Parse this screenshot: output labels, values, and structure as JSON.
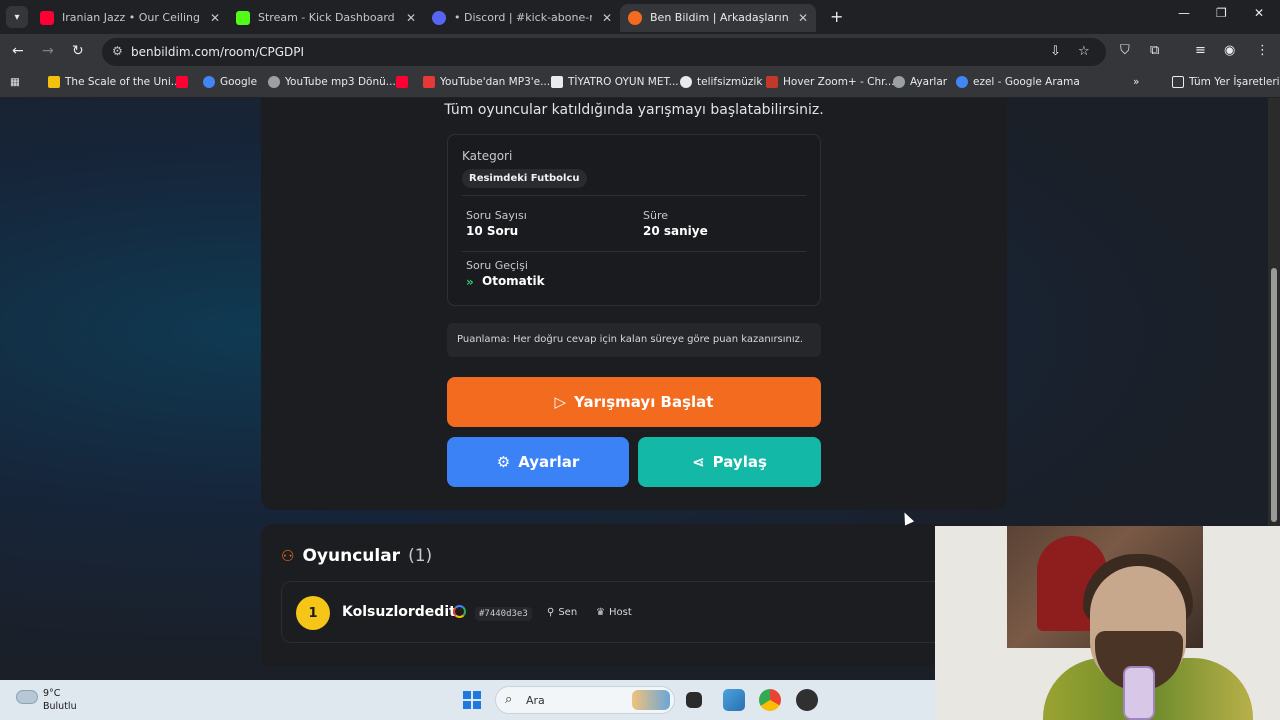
{
  "browser": {
    "tabs": [
      {
        "title": "Iranian Jazz • Our Ceilings Fell A",
        "favicon_color": "#ff0033",
        "active": false
      },
      {
        "title": "Stream - Kick Dashboard",
        "favicon_color": "#53fc18",
        "active": false
      },
      {
        "title": "• Discord | #kick-abone-rolu-al",
        "favicon_color": "#5865f2",
        "active": false
      },
      {
        "title": "Ben Bildim | Arkadaşlarınla Onli",
        "favicon_color": "#f26b1f",
        "active": true
      }
    ],
    "url": "benbildim.com/room/CPGDPI",
    "bookmarks": [
      {
        "label": "The Scale of the Uni...",
        "color": "#f4c20d"
      },
      {
        "label": "",
        "color": "#ff0033"
      },
      {
        "label": "Google",
        "color": "#4285f4"
      },
      {
        "label": "YouTube mp3 Dönü...",
        "color": "#9aa0a6"
      },
      {
        "label": "",
        "color": "#ff0033"
      },
      {
        "label": "YouTube'dan MP3'e...",
        "color": "#e53935"
      },
      {
        "label": "TİYATRO OYUN MET...",
        "color": "#e8eaed"
      },
      {
        "label": "telifsizmüzik",
        "color": "#e8eaed"
      },
      {
        "label": "Hover Zoom+ - Chr...",
        "color": "#c0392b"
      },
      {
        "label": "Ayarlar",
        "color": "#9aa0a6"
      },
      {
        "label": "ezel - Google Arama",
        "color": "#4285f4"
      }
    ],
    "all_bookmarks": "Tüm Yer İşaretleri"
  },
  "room": {
    "subtitle": "Tüm oyuncular katıldığında yarışmayı başlatabilirsiniz.",
    "category_label": "Kategori",
    "category_value": "Resimdeki Futbolcu",
    "question_count_label": "Soru Sayısı",
    "question_count_value": "10 Soru",
    "duration_label": "Süre",
    "duration_value": "20 saniye",
    "transition_label": "Soru Geçişi",
    "transition_value": "Otomatik",
    "scoring_note": "Puanlama: Her doğru cevap için kalan süreye göre puan kazanırsınız.",
    "start_button": "Yarışmayı Başlat",
    "settings_button": "Ayarlar",
    "share_button": "Paylaş"
  },
  "players": {
    "title": "Oyuncular",
    "count": "(1)",
    "list": [
      {
        "rank": "1",
        "name": "Kolsuzlordedit",
        "id": "#7440d3e3",
        "tag_you": "Sen",
        "tag_host": "Host"
      }
    ]
  },
  "taskbar": {
    "temperature": "9°C",
    "condition": "Bulutlu",
    "search_placeholder": "Ara"
  },
  "colors": {
    "accent_orange": "#f26b1f",
    "settings_blue": "#3b82f6",
    "share_teal": "#14b8a6",
    "rank_gold": "#f5c518",
    "chevron_green": "#2ecc71"
  }
}
